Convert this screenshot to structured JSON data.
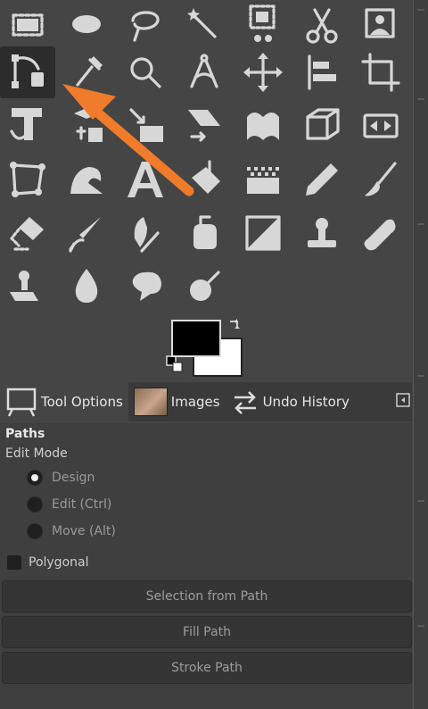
{
  "tools": [
    {
      "name": "rectangle-select-icon"
    },
    {
      "name": "ellipse-select-icon"
    },
    {
      "name": "lasso-select-icon"
    },
    {
      "name": "fuzzy-select-icon"
    },
    {
      "name": "foreground-select-icon"
    },
    {
      "name": "scissors-select-icon"
    },
    {
      "name": "intelligent-scissors-icon"
    },
    {
      "name": "paths-tool-icon",
      "active": true
    },
    {
      "name": "color-picker-icon"
    },
    {
      "name": "zoom-icon"
    },
    {
      "name": "measure-icon"
    },
    {
      "name": "move-icon"
    },
    {
      "name": "align-icon"
    },
    {
      "name": "crop-icon"
    },
    {
      "name": "unified-transform-icon"
    },
    {
      "name": "text-transform-icon"
    },
    {
      "name": "scale-icon"
    },
    {
      "name": "shear-icon"
    },
    {
      "name": "warp-transform-icon"
    },
    {
      "name": "perspective-icon"
    },
    {
      "name": "flip-icon"
    },
    {
      "name": "cage-transform-icon"
    },
    {
      "name": "smudge-wave-icon"
    },
    {
      "name": "text-tool-icon"
    },
    {
      "name": "bucket-fill-icon"
    },
    {
      "name": "gradient-icon"
    },
    {
      "name": "pencil-icon"
    },
    {
      "name": "paintbrush-icon"
    },
    {
      "name": "eraser-icon"
    },
    {
      "name": "airbrush-icon"
    },
    {
      "name": "ink-icon"
    },
    {
      "name": "mypaint-brush-icon"
    },
    {
      "name": "heal-perspective-icon"
    },
    {
      "name": "clone-icon"
    },
    {
      "name": "heal-icon"
    },
    {
      "name": "perspective-clone-icon"
    },
    {
      "name": "blur-sharpen-icon"
    },
    {
      "name": "smudge-icon"
    },
    {
      "name": "dodge-burn-icon"
    }
  ],
  "tabs": {
    "tool_options": "Tool Options",
    "images": "Images",
    "undo_history": "Undo History"
  },
  "panel": {
    "title": "Paths",
    "edit_mode_label": "Edit Mode",
    "modes": [
      "Design",
      "Edit (Ctrl)",
      "Move (Alt)"
    ],
    "selected_mode": "Design",
    "polygonal_label": "Polygonal",
    "buttons": [
      "Selection from Path",
      "Fill Path",
      "Stroke Path"
    ]
  },
  "colors": {
    "foreground": "#000000",
    "background": "#ffffff",
    "arrow": "#f07b2a"
  }
}
